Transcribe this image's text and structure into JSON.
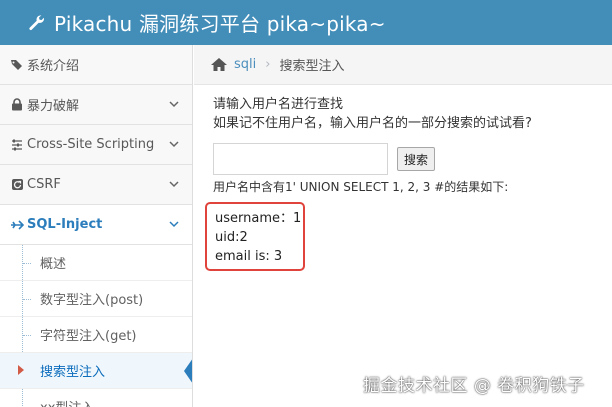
{
  "header": {
    "title": "Pikachu 漏洞练习平台 pika~pika~",
    "logo_icon": "wrench-icon"
  },
  "sidebar": {
    "items": [
      {
        "label": "系统介绍",
        "icon": "tags-icon",
        "has_chevron": false
      },
      {
        "label": "暴力破解",
        "icon": "lock-icon",
        "has_chevron": true
      },
      {
        "label": "Cross-Site Scripting",
        "icon": "sliders-icon",
        "has_chevron": true
      },
      {
        "label": "CSRF",
        "icon": "refresh-icon",
        "has_chevron": true
      },
      {
        "label": "SQL-Inject",
        "icon": "plane-icon",
        "has_chevron": true,
        "active": true
      }
    ],
    "sub_items": [
      {
        "label": "概述"
      },
      {
        "label": "数字型注入(post)"
      },
      {
        "label": "字符型注入(get)"
      },
      {
        "label": "搜索型注入",
        "active": true
      },
      {
        "label": "xx型注入"
      }
    ]
  },
  "breadcrumb": {
    "home_icon": "home-icon",
    "link": "sqli",
    "current": "搜索型注入"
  },
  "main": {
    "prompt_line1": "请输入用户名进行查找",
    "prompt_line2": "如果记不住用户名，输入用户名的一部分搜索的试试看?",
    "search_value": "",
    "search_button": "搜索",
    "result_title": "用户名中含有1' UNION SELECT 1, 2, 3 #的结果如下:",
    "result_lines": [
      "username：1",
      "uid:2",
      "email is: 3"
    ]
  },
  "watermark": "掘金技术社区 @ 卷积狗铁子",
  "colors": {
    "header_bg": "#438eb9",
    "active_accent": "#2b7dbc",
    "result_border": "#e0433b"
  }
}
